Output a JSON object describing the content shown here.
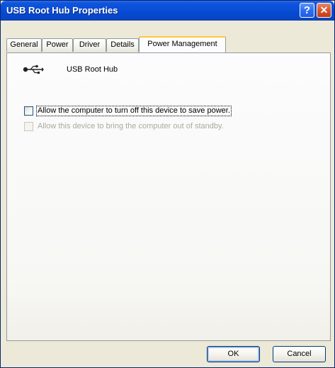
{
  "window": {
    "title": "USB Root Hub Properties",
    "help_label": "?",
    "close_label": "✕"
  },
  "tabs": [
    {
      "label": "General",
      "active": false
    },
    {
      "label": "Power",
      "active": false
    },
    {
      "label": "Driver",
      "active": false
    },
    {
      "label": "Details",
      "active": false
    },
    {
      "label": "Power Management",
      "active": true
    }
  ],
  "device": {
    "name": "USB Root Hub",
    "icon": "usb-icon"
  },
  "options": [
    {
      "label": "Allow the computer to turn off this device to save power.",
      "checked": false,
      "enabled": true
    },
    {
      "label": "Allow this device to bring the computer out of standby.",
      "checked": false,
      "enabled": false
    }
  ],
  "buttons": {
    "ok_label": "OK",
    "cancel_label": "Cancel"
  },
  "colors": {
    "titlebar": "#0548cf",
    "active_tab_accent": "#ffc83c",
    "close_button": "#d9552c"
  }
}
